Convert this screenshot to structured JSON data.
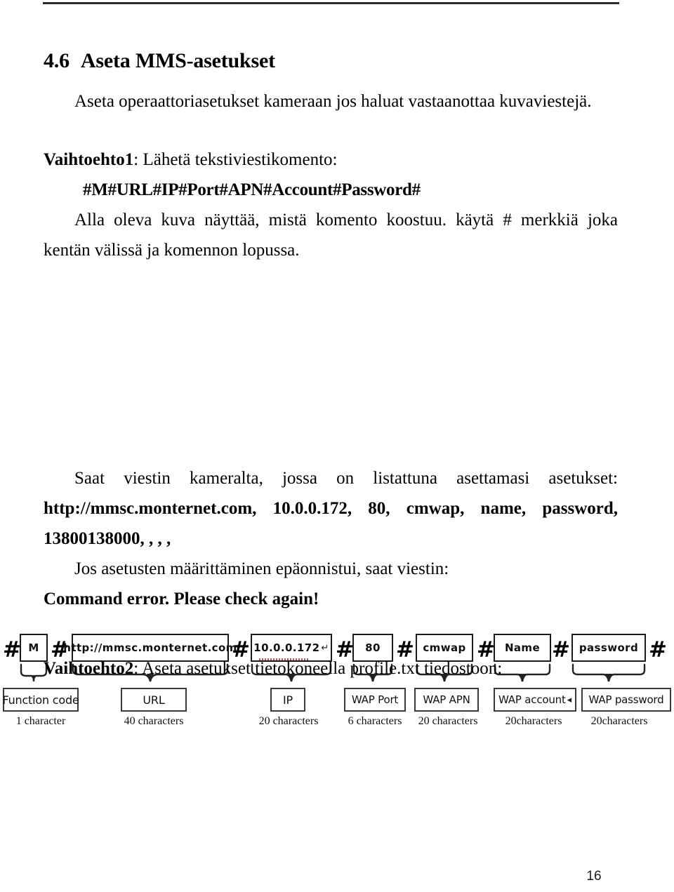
{
  "document": {
    "page_number": "16",
    "header_rule": true
  },
  "section": {
    "number": "4.6",
    "title": "Aseta MMS-asetukset",
    "intro": "Aseta operaattoriasetukset kameraan jos haluat vastaanottaa kuvaviestejä."
  },
  "option1": {
    "label": "Vaihtoehto1",
    "label_rest": ": Lähetä tekstiviestikomento:",
    "command": "#M#URL#IP#Port#APN#Account#Password#",
    "explanation": "Alla oleva kuva näyttää, mistä komento koostuu. käytä # merkkiä joka kentän välissä ja komennon lopussa."
  },
  "diagram": {
    "separator": "#",
    "fields": [
      {
        "value": "M",
        "label": "Function code",
        "chars": "1 character"
      },
      {
        "value": "http://mmsc.monternet.com",
        "label": "URL",
        "chars": "40 characters"
      },
      {
        "value": "10.0.0.172",
        "value_mark": "↵",
        "label": "IP",
        "chars": "20 characters"
      },
      {
        "value": "80",
        "label": "WAP Port",
        "chars": "6 characters"
      },
      {
        "value": "cmwap",
        "label": "WAP APN",
        "chars": "20 characters"
      },
      {
        "value": "Name",
        "label": "WAP account",
        "label_mark": "◂",
        "chars": "20characters"
      },
      {
        "value": "password",
        "label": "WAP password",
        "chars": "20characters"
      }
    ]
  },
  "result": {
    "lead": "Saat viestin kameralta, jossa on listattuna asettamasi asetukset:",
    "settings": "http://mmsc.monternet.com,  10.0.0.172,  80, cmwap, name, password, 13800138000, , , ,",
    "error_lead": "Jos asetusten määrittäminen epäonnistui, saat viestin:",
    "error_message": "Command error. Please check again!"
  },
  "option2": {
    "label": "Vaihtoehto2",
    "label_rest": ": Aseta asetukset tietokoneella profile.txt tiedostoon:"
  },
  "colors": {
    "text": "#000000",
    "rule": "#2a2a2a",
    "box_border": "#1a1a1a",
    "spellcheck_underline": "#c0392b",
    "page_background": "#ffffff"
  }
}
